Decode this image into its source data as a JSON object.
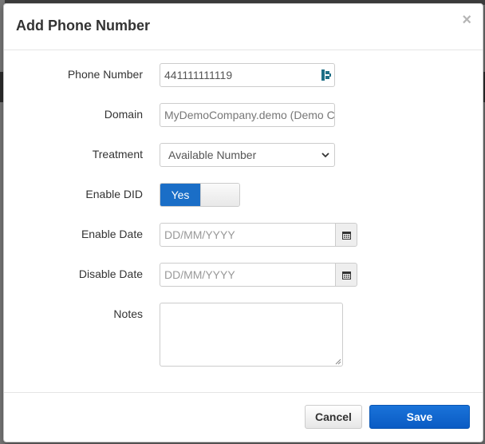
{
  "dialog": {
    "title": "Add Phone Number",
    "close_label": "×"
  },
  "form": {
    "phone_number": {
      "label": "Phone Number",
      "value": "441111111119"
    },
    "domain": {
      "label": "Domain",
      "value": "MyDemoCompany.demo (Demo Con"
    },
    "treatment": {
      "label": "Treatment",
      "selected": "Available Number"
    },
    "enable_did": {
      "label": "Enable DID",
      "state_label": "Yes",
      "enabled": true
    },
    "enable_date": {
      "label": "Enable Date",
      "placeholder": "DD/MM/YYYY"
    },
    "disable_date": {
      "label": "Disable Date",
      "placeholder": "DD/MM/YYYY"
    },
    "notes": {
      "label": "Notes",
      "value": ""
    }
  },
  "footer": {
    "cancel_label": "Cancel",
    "save_label": "Save"
  },
  "colors": {
    "primary": "#0a5bc4",
    "toggle_on": "#1a6ec7"
  },
  "icons": {
    "phone_field": "contact-card-icon",
    "calendar": "calendar-icon",
    "select": "chevron-down-icon",
    "close": "close-icon"
  }
}
